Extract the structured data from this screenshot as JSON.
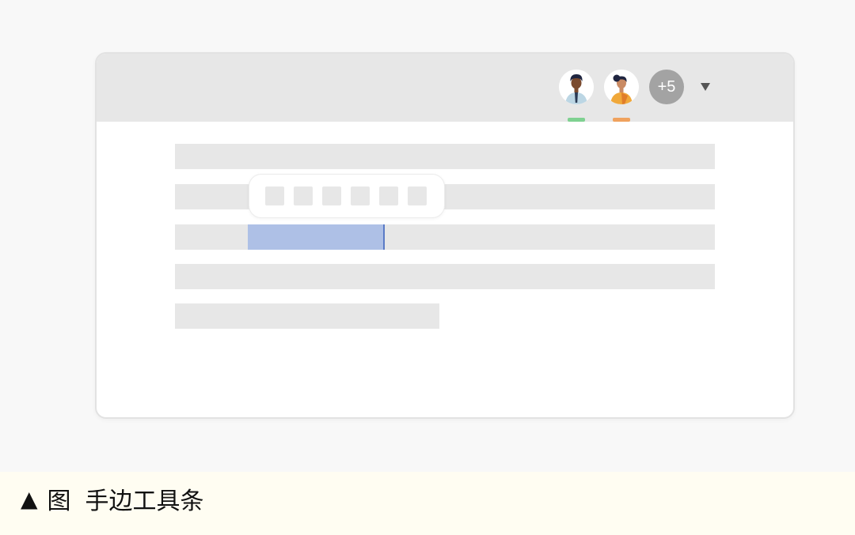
{
  "window": {
    "collaborators": [
      {
        "name_icon": "collaborator-avatar-man",
        "presence_color": "#7fd191"
      },
      {
        "name_icon": "collaborator-avatar-woman",
        "presence_color": "#f0a25e"
      }
    ],
    "more_count": "+5",
    "dropdown_icon": "▼"
  },
  "hand_toolbar": {
    "button_count": 6
  },
  "colors": {
    "titlebar": "#e7e7e7",
    "placeholder_line": "#e7e7e7",
    "selection": "#aec0e6",
    "cursor": "#5b7bc6"
  },
  "caption": {
    "marker": "▲",
    "label": "图",
    "text": "手边工具条"
  }
}
